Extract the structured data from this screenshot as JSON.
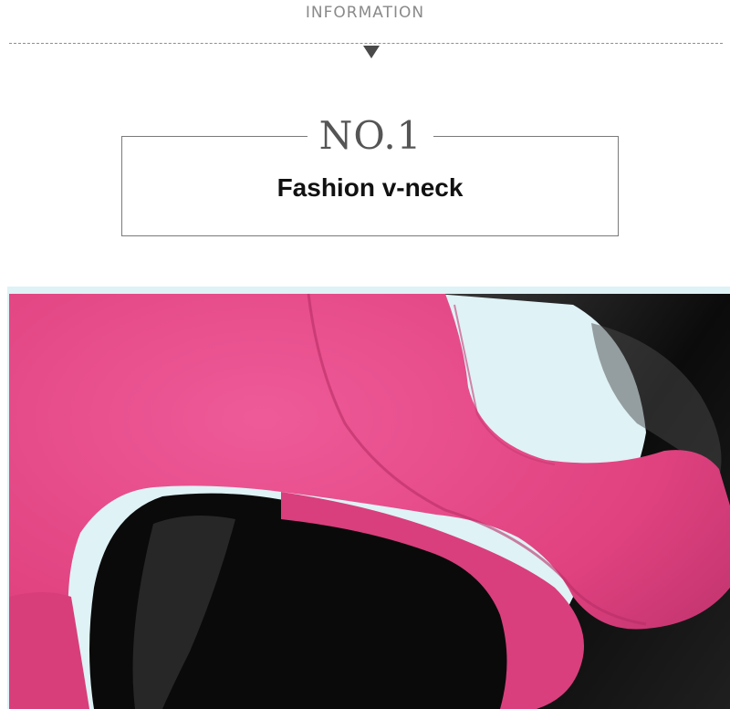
{
  "header": {
    "title": "INFORMATION"
  },
  "feature": {
    "number": "NO.1",
    "title": "Fashion v-neck"
  },
  "photo": {
    "fleece_color": "#e64587",
    "mannequin_color": "#0c0c0c"
  }
}
